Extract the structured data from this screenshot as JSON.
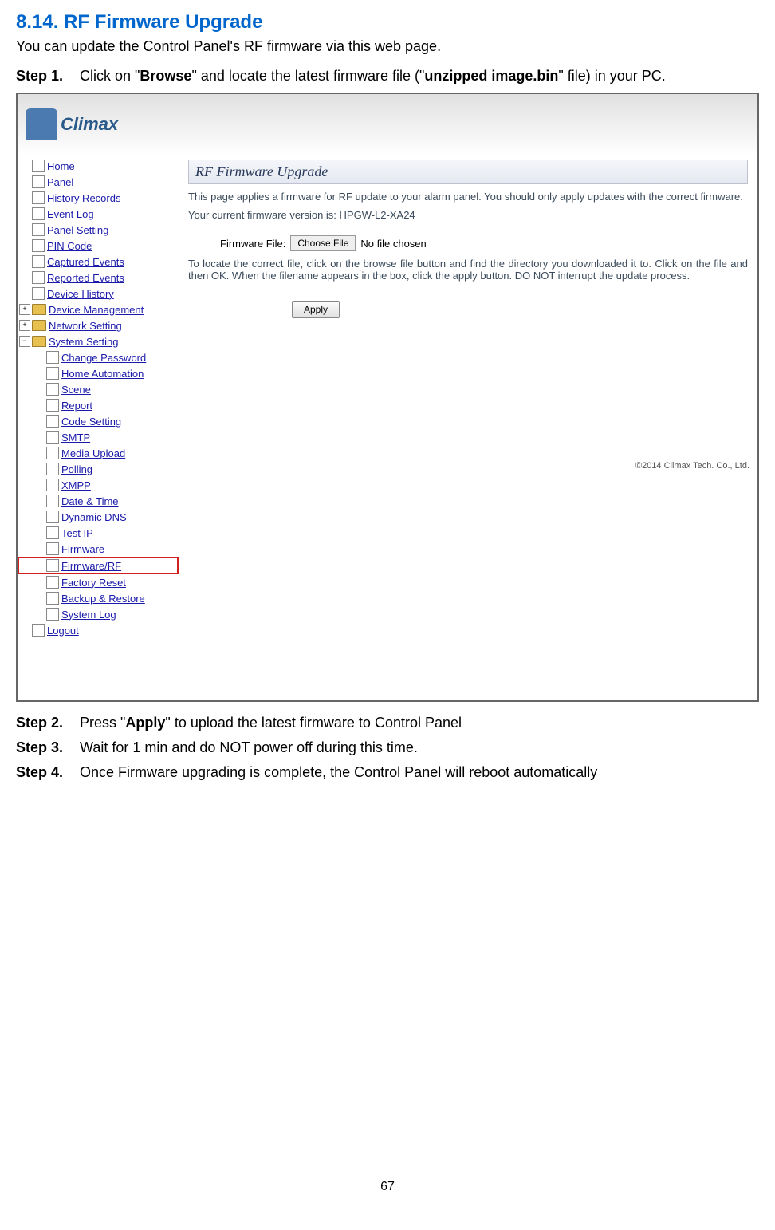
{
  "doc": {
    "section_title": "8.14. RF Firmware Upgrade",
    "intro": "You can update the Control Panel's RF firmware via this web page.",
    "step1_label": "Step 1.",
    "step1_text_a": "Click on \"",
    "step1_browse": "Browse",
    "step1_text_b": "\" and locate the latest firmware file (\"",
    "step1_filename": "unzipped image.bin",
    "step1_text_c": "\" file) in your PC.",
    "step2_label": "Step 2.",
    "step2_text_a": "Press \"",
    "step2_apply": "Apply",
    "step2_text_b": "\" to upload the latest firmware to Control Panel",
    "step3_label": "Step 3.",
    "step3_text": "Wait for 1 min and do NOT power off during this time.",
    "step4_label": "Step 4.",
    "step4_text": "Once Firmware upgrading is complete, the Control Panel will reboot automatically",
    "page_number": "67"
  },
  "ui": {
    "logo_text": "Climax",
    "nav": {
      "home": "Home",
      "panel": "Panel",
      "history_records": "History Records",
      "event_log": "Event Log",
      "panel_setting": "Panel Setting",
      "pin_code": "PIN Code",
      "captured_events": "Captured Events",
      "reported_events": "Reported Events",
      "device_history": "Device History",
      "device_management": "Device Management",
      "network_setting": "Network Setting",
      "system_setting": "System Setting",
      "change_password": "Change Password",
      "home_automation": "Home Automation",
      "scene": "Scene",
      "report": "Report",
      "code_setting": "Code Setting",
      "smtp": "SMTP",
      "media_upload": "Media Upload",
      "polling": "Polling",
      "xmpp": "XMPP",
      "date_time": "Date & Time",
      "dynamic_dns": "Dynamic DNS",
      "test_ip": "Test IP",
      "firmware": "Firmware",
      "firmware_rf": "Firmware/RF",
      "factory_reset": "Factory Reset",
      "backup_restore": "Backup & Restore",
      "system_log": "System Log",
      "logout": "Logout"
    },
    "main": {
      "title": "RF Firmware Upgrade",
      "desc1": "This page applies a firmware for RF update to your alarm panel. You should only apply updates with the correct firmware.",
      "version_label": "Your current firmware version is: HPGW-L2-XA24",
      "file_label": "Firmware File:",
      "choose_btn": "Choose File",
      "no_file": "No file chosen",
      "desc2": "To locate the correct file, click on the browse file button and find the directory you downloaded it to. Click on the file and then OK. When the filename appears in the box, click the apply button. DO NOT interrupt the update process.",
      "apply_btn": "Apply",
      "copyright": "©2014 Climax Tech. Co., Ltd."
    }
  }
}
